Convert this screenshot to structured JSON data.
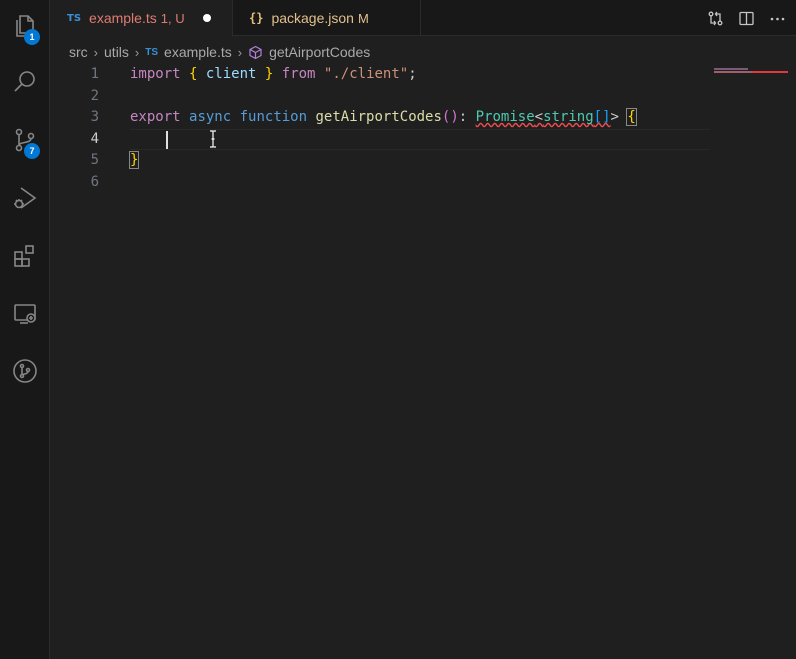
{
  "activity_bar": {
    "items": [
      {
        "name": "explorer",
        "icon": "files-icon",
        "badge": "1"
      },
      {
        "name": "search",
        "icon": "search-icon"
      },
      {
        "name": "source-control",
        "icon": "source-control-icon",
        "badge": "7"
      },
      {
        "name": "run-debug",
        "icon": "run-debug-icon"
      },
      {
        "name": "extensions",
        "icon": "extensions-icon"
      },
      {
        "name": "remote-explorer",
        "icon": "remote-explorer-icon"
      },
      {
        "name": "git-graph",
        "icon": "git-graph-icon"
      }
    ]
  },
  "tabs": [
    {
      "icon_text": "TS",
      "label": "example.ts",
      "status": "1, U",
      "active": true,
      "dirty": true
    },
    {
      "icon_text": "{}",
      "label": "package.json",
      "status": "M",
      "active": false
    }
  ],
  "breadcrumb": {
    "parts": [
      "src",
      "utils"
    ],
    "file_icon": "TS",
    "file": "example.ts",
    "symbol": "getAirportCodes"
  },
  "editor": {
    "current_line": 4,
    "lines": [
      {
        "n": "1",
        "tokens": [
          {
            "t": "import",
            "c": "kw"
          },
          {
            "t": " ",
            "c": "pun"
          },
          {
            "t": "{",
            "c": "br1"
          },
          {
            "t": " client ",
            "c": "var"
          },
          {
            "t": "}",
            "c": "br1"
          },
          {
            "t": " ",
            "c": "pun"
          },
          {
            "t": "from",
            "c": "kw"
          },
          {
            "t": " ",
            "c": "pun"
          },
          {
            "t": "\"./client\"",
            "c": "str"
          },
          {
            "t": ";",
            "c": "pun"
          }
        ]
      },
      {
        "n": "2",
        "tokens": []
      },
      {
        "n": "3",
        "tokens": [
          {
            "t": "export",
            "c": "kw"
          },
          {
            "t": " ",
            "c": "pun"
          },
          {
            "t": "async",
            "c": "kw2"
          },
          {
            "t": " ",
            "c": "pun"
          },
          {
            "t": "function",
            "c": "kw2"
          },
          {
            "t": " ",
            "c": "pun"
          },
          {
            "t": "getAirportCodes",
            "c": "fn"
          },
          {
            "t": "()",
            "c": "br2"
          },
          {
            "t": ": ",
            "c": "pun"
          },
          {
            "t": "Promise",
            "c": "type err"
          },
          {
            "t": "<",
            "c": "pun err"
          },
          {
            "t": "string",
            "c": "type err"
          },
          {
            "t": "[]",
            "c": "br3 err"
          },
          {
            "t": ">",
            "c": "pun"
          },
          {
            "t": " ",
            "c": "pun"
          },
          {
            "t": "{",
            "c": "br1 brmatch"
          }
        ]
      },
      {
        "n": "4",
        "tokens": []
      },
      {
        "n": "5",
        "tokens": [
          {
            "t": "}",
            "c": "br1 brmatch"
          }
        ]
      },
      {
        "n": "6",
        "tokens": []
      }
    ]
  },
  "colors": {
    "background": "#1f1f1f",
    "accent_badge": "#0078d4",
    "modified_tab": "#e07b72",
    "json_tab": "#e2c08d"
  }
}
